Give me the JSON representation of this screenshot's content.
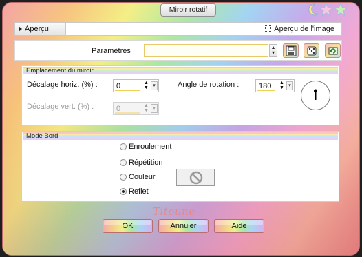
{
  "window": {
    "title": "Miroir rotatif"
  },
  "preview": {
    "tab_label": "Aperçu",
    "image_preview_label": "Aperçu de l'image"
  },
  "settings": {
    "label": "Paramètres",
    "value": ""
  },
  "mirror_group": {
    "title": "Emplacement du miroir",
    "horiz_label": "Décalage horiz. (%) :",
    "horiz_value": "0",
    "vert_label": "Décalage vert. (%) :",
    "vert_value": "0",
    "angle_label": "Angle de rotation :",
    "angle_value": "180"
  },
  "edge_group": {
    "title": "Mode Bord",
    "options": [
      "Enroulement",
      "Répétition",
      "Couleur",
      "Reflet"
    ],
    "selected": "Reflet"
  },
  "signature": "Titoune",
  "buttons": {
    "ok": "OK",
    "cancel": "Annuler",
    "help": "Aide"
  },
  "colors": {
    "accent_yellow": "#f0cf55",
    "frame_border": "#bb6b6b",
    "signature": "#e38a8a"
  }
}
